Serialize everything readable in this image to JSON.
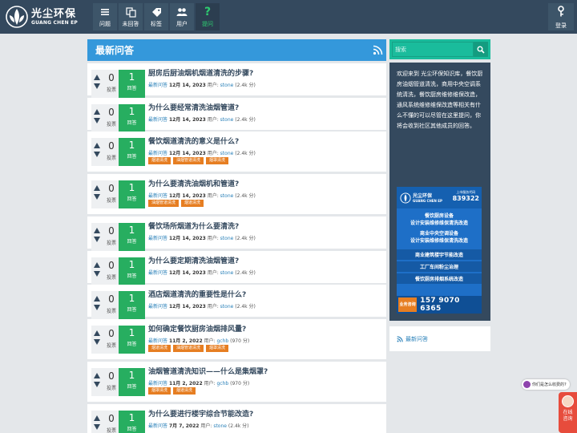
{
  "brand": {
    "name_cn": "光尘环保",
    "name_en": "GUANG CHEN EP"
  },
  "nav": [
    {
      "label": "问题",
      "icon": "list-icon"
    },
    {
      "label": "未回答",
      "icon": "questions-icon"
    },
    {
      "label": "标签",
      "icon": "tag-icon"
    },
    {
      "label": "用户",
      "icon": "users-icon"
    },
    {
      "label": "提问",
      "icon": "question-mark-icon"
    }
  ],
  "login_label": "登录",
  "main": {
    "title": "最新问答",
    "questions": [
      {
        "title": "厨房后厨油烟机烟道清洗的步骤?",
        "votes": "0",
        "votes_label": "投票",
        "answers": "1",
        "answers_label": "回答",
        "category": "最新问答",
        "date": "12月 14, 2023",
        "user_prefix": "用户:",
        "user": "stone",
        "points": "(2.4k 分)",
        "tags": []
      },
      {
        "title": "为什么要经常清洗油烟管道?",
        "votes": "0",
        "votes_label": "投票",
        "answers": "1",
        "answers_label": "回答",
        "category": "最新问答",
        "date": "12月 14, 2023",
        "user_prefix": "用户:",
        "user": "stone",
        "points": "(2.4k 分)",
        "tags": []
      },
      {
        "title": "餐饮烟道清洗的意义是什么?",
        "votes": "0",
        "votes_label": "投票",
        "answers": "1",
        "answers_label": "回答",
        "category": "最新问答",
        "date": "12月 14, 2023",
        "user_prefix": "用户:",
        "user": "stone",
        "points": "(2.4k 分)",
        "tags": [
          "烟道清洗",
          "油烟管道清洗",
          "烟罩清洗"
        ]
      },
      {
        "title": "为什么要清洗油烟机和管道?",
        "votes": "0",
        "votes_label": "投票",
        "answers": "1",
        "answers_label": "回答",
        "category": "最新问答",
        "date": "12月 14, 2023",
        "user_prefix": "用户:",
        "user": "stone",
        "points": "(2.4k 分)",
        "tags": [
          "油烟管道清洗",
          "烟道清洗"
        ]
      },
      {
        "title": "餐饮场所烟道为什么要清洗?",
        "votes": "0",
        "votes_label": "投票",
        "answers": "1",
        "answers_label": "回答",
        "category": "最新问答",
        "date": "12月 14, 2023",
        "user_prefix": "用户:",
        "user": "stone",
        "points": "(2.4k 分)",
        "tags": []
      },
      {
        "title": "为什么要定期清洗油烟管道?",
        "votes": "0",
        "votes_label": "投票",
        "answers": "1",
        "answers_label": "回答",
        "category": "最新问答",
        "date": "12月 14, 2023",
        "user_prefix": "用户:",
        "user": "stone",
        "points": "(2.4k 分)",
        "tags": []
      },
      {
        "title": "酒店烟道清洗的重要性是什么?",
        "votes": "0",
        "votes_label": "投票",
        "answers": "1",
        "answers_label": "回答",
        "category": "最新问答",
        "date": "12月 14, 2023",
        "user_prefix": "用户:",
        "user": "stone",
        "points": "(2.4k 分)",
        "tags": []
      },
      {
        "title": "如何确定餐饮厨房油烟排风量?",
        "votes": "0",
        "votes_label": "投票",
        "answers": "1",
        "answers_label": "回答",
        "category": "最新问答",
        "date": "11月 2, 2022",
        "user_prefix": "用户:",
        "user": "gchb",
        "points": "(970 分)",
        "tags": [
          "烟道清洗",
          "油烟管道清洗",
          "烟罩清洗"
        ]
      },
      {
        "title": "油烟管道清洗知识——什么是集烟罩?",
        "votes": "0",
        "votes_label": "投票",
        "answers": "1",
        "answers_label": "回答",
        "category": "最新问答",
        "date": "11月 2, 2022",
        "user_prefix": "用户:",
        "user": "gchb",
        "points": "(970 分)",
        "tags": [
          "烟罩清洗",
          "烟道清洗"
        ]
      },
      {
        "title": "为什么要进行楼宇综合节能改造?",
        "votes": "0",
        "votes_label": "投票",
        "answers": "1",
        "answers_label": "回答",
        "category": "最新问答",
        "date": "7月 7, 2022",
        "user_prefix": "用户:",
        "user": "stone",
        "points": "(2.4k 分)",
        "tags": []
      }
    ]
  },
  "sidebar": {
    "search_placeholder": "搜索",
    "welcome": "欢迎来到 光尘环保知识库，餐饮厨房油烟管道清洗，商用中央空调系统清洗，餐饮厨房维修维保改造，通风系统维修维保改造等相关有什么不懂的可以尽管在这里提问，你将会收到社区其他成员的回答。",
    "ad": {
      "brand_cn": "光尘环保",
      "brand_en": "GUANG CHEN EP",
      "phone_label": "上市服务代码",
      "phone": "839322",
      "lines": [
        "餐饮厨房设备",
        "设计安装维修维保清洗改造",
        "商业中央空调设备",
        "设计安装维修维保清洗改造"
      ],
      "bands": [
        "商业建筑楼宇节能改造",
        "工厂车间粉尘治理",
        "餐饮厨房排烟系统改造"
      ],
      "badge": "业务咨询",
      "tel": "157 9070 6365"
    },
    "feed_label": "最新问答"
  },
  "float_ask": "你们是怎么收费的?",
  "chat_label": "在线咨询",
  "colors": {
    "topbar": "#34495e",
    "accent": "#3498db",
    "answer": "#27ae60",
    "tag": "#e67e22",
    "search": "#1abc9c"
  }
}
